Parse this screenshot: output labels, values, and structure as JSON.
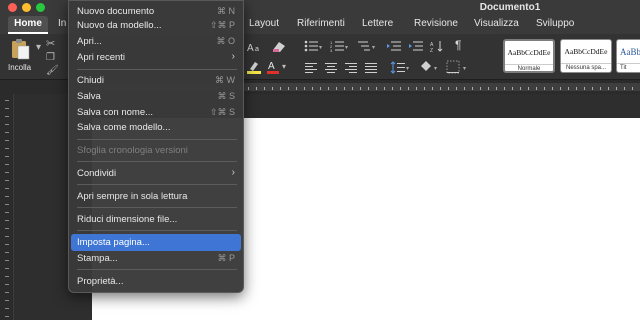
{
  "window": {
    "title": "Documento1"
  },
  "tabs": {
    "home": "Home",
    "insert_partial": "In",
    "items": [
      "Layout",
      "Riferimenti",
      "Lettere",
      "Revisione",
      "Visualizza",
      "Sviluppo"
    ]
  },
  "ribbon": {
    "paste_label": "Incolla",
    "styles": [
      {
        "sample": "AaBbCcDdEe",
        "name": "Normale"
      },
      {
        "sample": "AaBbCcDdEe",
        "name": "Nessuna spa..."
      },
      {
        "sample": "AaBbC",
        "name": "Tit"
      }
    ]
  },
  "menu": {
    "items": [
      {
        "label": "Nuovo documento",
        "shortcut": "⌘ N"
      },
      {
        "label": "Nuovo da modello...",
        "shortcut": "⇧⌘ P"
      },
      {
        "label": "Apri...",
        "shortcut": "⌘ O"
      },
      {
        "label": "Apri recenti",
        "shortcut": "›"
      },
      {
        "label": "Chiudi",
        "shortcut": "⌘ W"
      },
      {
        "label": "Salva",
        "shortcut": "⌘ S"
      },
      {
        "label": "Salva con nome...",
        "shortcut": "⇧⌘ S"
      },
      {
        "label": "Salva come modello...",
        "shortcut": ""
      },
      {
        "label": "Sfoglia cronologia versioni",
        "shortcut": ""
      },
      {
        "label": "Condividi",
        "shortcut": "›"
      },
      {
        "label": "Apri sempre in sola lettura",
        "shortcut": ""
      },
      {
        "label": "Riduci dimensione file...",
        "shortcut": ""
      },
      {
        "label": "Imposta pagina...",
        "shortcut": ""
      },
      {
        "label": "Stampa...",
        "shortcut": "⌘ P"
      },
      {
        "label": "Proprietà...",
        "shortcut": ""
      }
    ]
  },
  "colors": {
    "highlight": "#3f76d6",
    "menu_bg": "#3a3a3a",
    "font_color_bar": "#e0312a"
  }
}
